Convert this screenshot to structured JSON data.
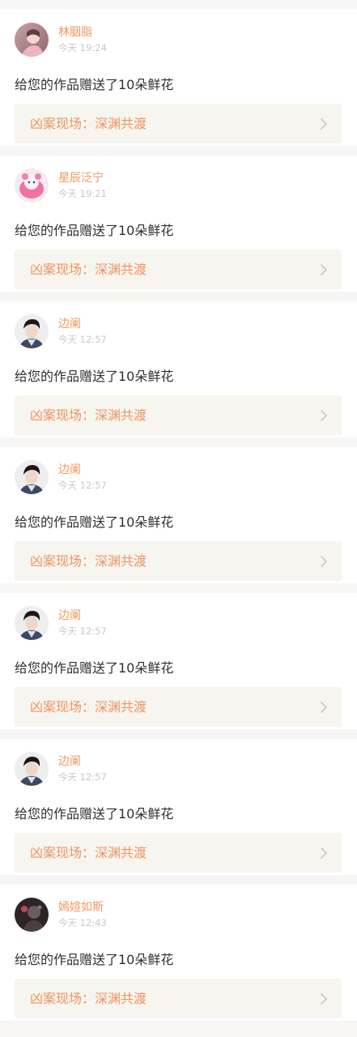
{
  "notifications": [
    {
      "user": "林胭脂",
      "time": "今天 19:24",
      "message": "给您的作品赠送了10朵鲜花",
      "work_title": "凶案现场：深渊共渡",
      "avatar_icon": "portrait-avatar-icon"
    },
    {
      "user": "星辰泛宁",
      "time": "今天 19:21",
      "message": "给您的作品赠送了10朵鲜花",
      "work_title": "凶案现场：深渊共渡",
      "avatar_icon": "pink-plush-avatar-icon"
    },
    {
      "user": "边阑",
      "time": "今天 12:57",
      "message": "给您的作品赠送了10朵鲜花",
      "work_title": "凶案现场：深渊共渡",
      "avatar_icon": "man-portrait-avatar-icon"
    },
    {
      "user": "边阑",
      "time": "今天 12:57",
      "message": "给您的作品赠送了10朵鲜花",
      "work_title": "凶案现场：深渊共渡",
      "avatar_icon": "man-portrait-avatar-icon"
    },
    {
      "user": "边阑",
      "time": "今天 12:57",
      "message": "给您的作品赠送了10朵鲜花",
      "work_title": "凶案现场：深渊共渡",
      "avatar_icon": "man-portrait-avatar-icon"
    },
    {
      "user": "边阑",
      "time": "今天 12:57",
      "message": "给您的作品赠送了10朵鲜花",
      "work_title": "凶案现场：深渊共渡",
      "avatar_icon": "man-portrait-avatar-icon"
    },
    {
      "user": "嫣媗如斯",
      "time": "今天 12:43",
      "message": "给您的作品赠送了10朵鲜花",
      "work_title": "凶案现场：深渊共渡",
      "avatar_icon": "dark-portrait-avatar-icon"
    }
  ],
  "icons": {
    "link_chevron": "chevron-right-icon"
  },
  "colors": {
    "page_background": "#f8f5f5",
    "card_background": "#ffffff",
    "username": "#f0975f",
    "work_title": "#ee9460",
    "timestamp": "#c8c8c8",
    "message_text": "#2f2f2f",
    "work_link_background": "#f6f5ef",
    "chevron": "#c9c9c9"
  }
}
